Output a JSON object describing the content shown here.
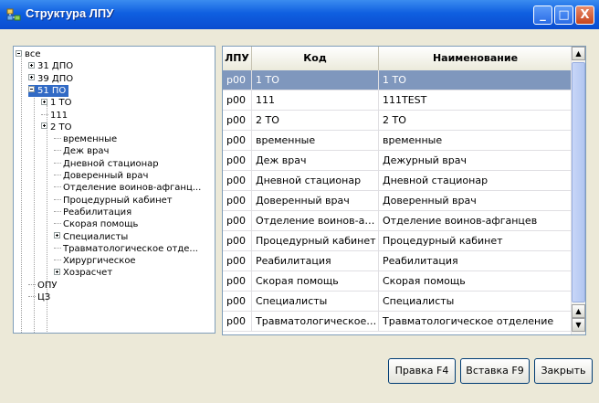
{
  "window": {
    "title": "Структура ЛПУ"
  },
  "titlebar_buttons": {
    "minimize": "_",
    "maximize": "□",
    "close": "X"
  },
  "tree": [
    {
      "label": "все",
      "expander": "minus"
    },
    {
      "label": "31 ДПО",
      "expander": "plus"
    },
    {
      "label": "39 ДПО",
      "expander": "plus"
    },
    {
      "label": "51 ПО",
      "expander": "minus",
      "selected": true
    },
    {
      "label": "1 ТО",
      "expander": "plus"
    },
    {
      "label": "111",
      "expander": "none"
    },
    {
      "label": "2 ТО",
      "expander": "plus"
    },
    {
      "label": "временные",
      "expander": "none"
    },
    {
      "label": "Деж врач",
      "expander": "none"
    },
    {
      "label": "Дневной стационар",
      "expander": "none"
    },
    {
      "label": "Доверенный врач",
      "expander": "none"
    },
    {
      "label": "Отделение воинов-афганц...",
      "expander": "none"
    },
    {
      "label": "Процедурный кабинет",
      "expander": "none"
    },
    {
      "label": "Реабилитация",
      "expander": "none"
    },
    {
      "label": "Скорая помощь",
      "expander": "none"
    },
    {
      "label": "Специалисты",
      "expander": "plus"
    },
    {
      "label": "Травматологическое отде...",
      "expander": "none"
    },
    {
      "label": "Хирургическое",
      "expander": "none"
    },
    {
      "label": "Хозрасчет",
      "expander": "plus"
    },
    {
      "label": "ОПУ",
      "expander": "none"
    },
    {
      "label": "ЦЗ",
      "expander": "none"
    }
  ],
  "grid": {
    "columns": [
      "ЛПУ",
      "Код",
      "Наименование"
    ],
    "rows": [
      {
        "lpu": "p00",
        "code": "1 ТО",
        "name": "1 ТО",
        "selected": true
      },
      {
        "lpu": "p00",
        "code": "111",
        "name": "111TEST"
      },
      {
        "lpu": "p00",
        "code": "2 ТО",
        "name": "2 ТО"
      },
      {
        "lpu": "p00",
        "code": "временные",
        "name": "временные"
      },
      {
        "lpu": "p00",
        "code": "Деж врач",
        "name": "Дежурный врач"
      },
      {
        "lpu": "p00",
        "code": "Дневной стационар",
        "name": "Дневной стационар"
      },
      {
        "lpu": "p00",
        "code": "Доверенный врач",
        "name": "Доверенный врач"
      },
      {
        "lpu": "p00",
        "code": "Отделение воинов-афганцев",
        "name": "Отделение воинов-афганцев"
      },
      {
        "lpu": "p00",
        "code": "Процедурный кабинет",
        "name": "Процедурный кабинет"
      },
      {
        "lpu": "p00",
        "code": "Реабилитация",
        "name": "Реабилитация"
      },
      {
        "lpu": "p00",
        "code": "Скорая помощь",
        "name": "Скорая помощь"
      },
      {
        "lpu": "p00",
        "code": "Специалисты",
        "name": "Специалисты"
      },
      {
        "lpu": "p00",
        "code": "Травматологическое отделе...",
        "name": "Травматологическое отделение"
      }
    ]
  },
  "buttons": {
    "edit": "Правка F4",
    "insert": "Вставка F9",
    "close": "Закрыть"
  },
  "colors": {
    "titlebar": "#0F5FE0",
    "selection": "#316AC5",
    "grid_selection": "#7F97BD",
    "window_bg": "#ECE9D8"
  }
}
